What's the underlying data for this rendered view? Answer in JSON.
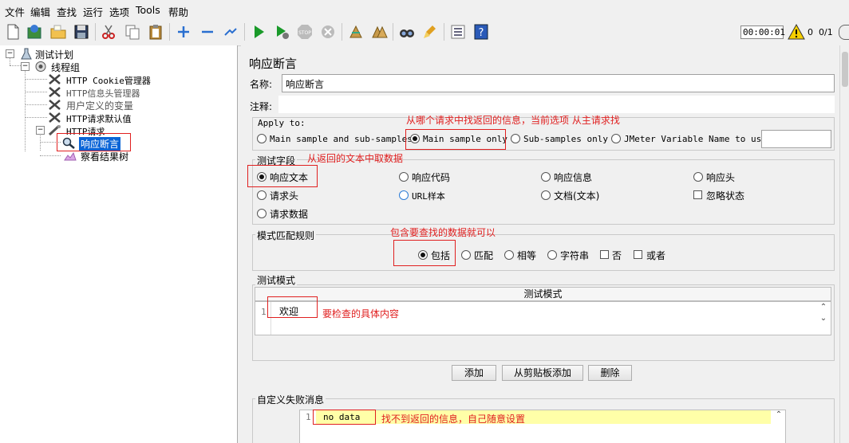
{
  "menubar": {
    "items": [
      "文件",
      "编辑",
      "查找",
      "运行",
      "选项",
      "Tools",
      "帮助"
    ]
  },
  "toolbar": {
    "icons": [
      "new-icon",
      "templates-icon",
      "open-icon",
      "save-icon",
      "cut-icon",
      "copy-icon",
      "paste-icon",
      "expand-icon",
      "collapse-icon",
      "toggle-icon",
      "start-icon",
      "start-no-pause-icon",
      "stop-icon",
      "shutdown-icon",
      "clear-icon",
      "clear-all-icon",
      "search-icon",
      "reset-search-icon",
      "function-helper-icon",
      "help-icon"
    ],
    "timer": "00:00:01",
    "warning_count": "0",
    "threads": "0/1"
  },
  "tree": {
    "items": [
      {
        "label": "测试计划",
        "icon": "test-plan-icon"
      },
      {
        "label": "线程组",
        "icon": "thread-group-icon"
      },
      {
        "label": "HTTP Cookie管理器",
        "icon": "config-icon"
      },
      {
        "label": "HTTP信息头管理器",
        "icon": "config-icon"
      },
      {
        "label": "用户定义的变量",
        "icon": "config-icon"
      },
      {
        "label": "HTTP请求默认值",
        "icon": "config-icon"
      },
      {
        "label": "HTTP请求",
        "icon": "sampler-icon"
      },
      {
        "label": "响应断言",
        "icon": "assertion-icon"
      },
      {
        "label": "察看结果树",
        "icon": "listener-icon"
      }
    ]
  },
  "panel": {
    "title": "响应断言",
    "name_label": "名称:",
    "name_value": "响应断言",
    "comment_label": "注释:",
    "comment_value": "",
    "apply_to": {
      "title": "Apply to:",
      "options": [
        "Main sample and sub-samples",
        "Main sample only",
        "Sub-samples only",
        "JMeter Variable Name to use"
      ],
      "selected": "Main sample only",
      "variable_value": ""
    },
    "test_field": {
      "title": "测试字段",
      "options": [
        "响应文本",
        "响应代码",
        "响应信息",
        "响应头",
        "请求头",
        "URL样本",
        "文档(文本)",
        "忽略状态",
        "请求数据"
      ],
      "selected": "响应文本"
    },
    "match_rule": {
      "title": "模式匹配规则",
      "options": [
        "包括",
        "匹配",
        "相等",
        "字符串",
        "否",
        "或者"
      ],
      "selected": "包括"
    },
    "patterns": {
      "title": "测试模式",
      "column_header": "测试模式",
      "line_number": "1",
      "rows": [
        "欢迎"
      ]
    },
    "buttons": {
      "add": "添加",
      "add_from_clipboard": "从剪贴板添加",
      "delete": "删除"
    },
    "failure_message": {
      "title": "自定义失败消息",
      "line_number": "1",
      "value": "no data"
    }
  },
  "annotations": {
    "apply_to_note": "从哪个请求中找返回的信息，当前选项 从主请求找",
    "field_note": "从返回的文本中取数据",
    "rule_note": "包含要查找的数据就可以",
    "pattern_note": "要检查的具体内容",
    "failure_note": "找不到返回的信息，自己随意设置"
  },
  "colors": {
    "annotation_red": "#e02020",
    "selection_blue": "#0a64d6",
    "editor_highlight": "#ffffa8"
  }
}
